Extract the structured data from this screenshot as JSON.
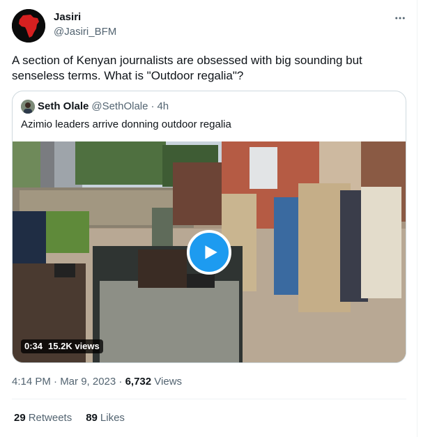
{
  "tweet": {
    "author": {
      "name": "Jasiri",
      "handle": "@Jasiri_BFM"
    },
    "text": "A section of Kenyan journalists are obsessed with big sounding but senseless terms. What is \"Outdoor regalia\"?",
    "timestamp": "4:14 PM · Mar 9, 2023 ·",
    "views": "6,732",
    "views_label": "Views",
    "retweets": "29",
    "retweets_label": "Retweets",
    "likes": "89",
    "likes_label": "Likes"
  },
  "quoted": {
    "author": {
      "name": "Seth Olale",
      "handle": "@SethOlale"
    },
    "separator": "·",
    "time": "4h",
    "text": "Azimio leaders arrive donning outdoor regalia",
    "video": {
      "duration": "0:34",
      "views": "15.2K views"
    }
  },
  "colors": {
    "accent": "#1d9bf0",
    "text_primary": "#0f1419",
    "text_secondary": "#536471",
    "border": "#cfd9de"
  },
  "icons": {
    "more": "more-horizontal-icon",
    "play": "play-icon"
  }
}
